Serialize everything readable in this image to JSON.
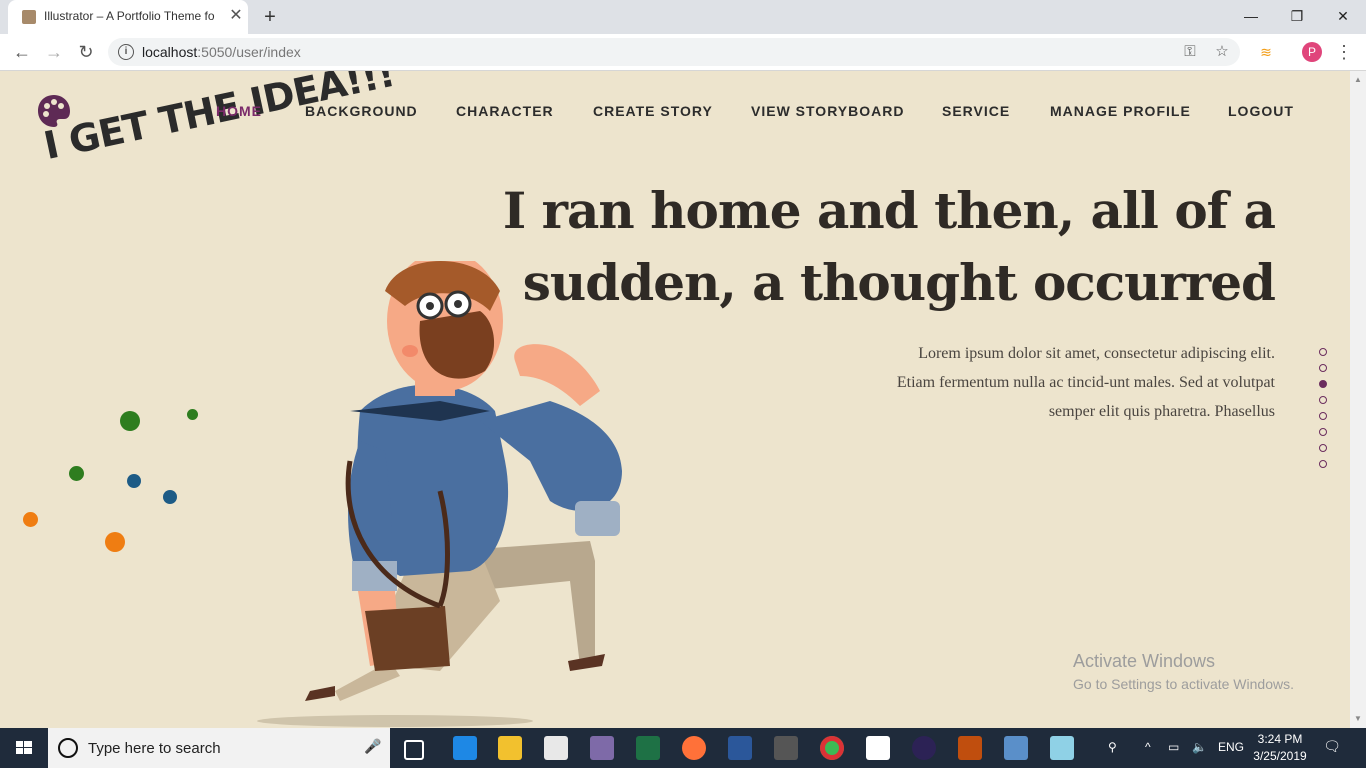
{
  "browser": {
    "tab_title": "Illustrator – A Portfolio Theme fo",
    "tab_close": "✕",
    "new_tab": "+",
    "url_host": "localhost",
    "url_port_path": ":5050/user/index",
    "window_controls": {
      "minimize": "—",
      "restore": "❐",
      "close": "✕"
    }
  },
  "site": {
    "logo_text": "I GET THE IDEA!!!",
    "nav": [
      "HOME",
      "BACKGROUND",
      "CHARACTER",
      "CREATE STORY",
      "VIEW STORYBOARD",
      "SERVICE",
      "MANAGE PROFILE",
      "LOGOUT"
    ],
    "active_nav": "HOME",
    "hero_title_line1": "I ran home and then, all of a",
    "hero_title_line2": "sudden, a thought occurred",
    "hero_text_line1": "Lorem ipsum dolor sit amet, consectetur adipiscing elit.",
    "hero_text_line2": "Etiam fermentum nulla ac tincid-unt males. Sed at volutpat",
    "hero_text_line3": "semper elit quis pharetra. Phasellus",
    "slide_count": 8,
    "active_slide": 3,
    "accent_color": "#6b2d5e"
  },
  "watermark": {
    "line1": "Activate Windows",
    "line2": "Go to Settings to activate Windows."
  },
  "taskbar": {
    "search_placeholder": "Type here to search",
    "language": "ENG",
    "time": "3:24 PM",
    "date": "3/25/2019",
    "notification_count": "1"
  }
}
